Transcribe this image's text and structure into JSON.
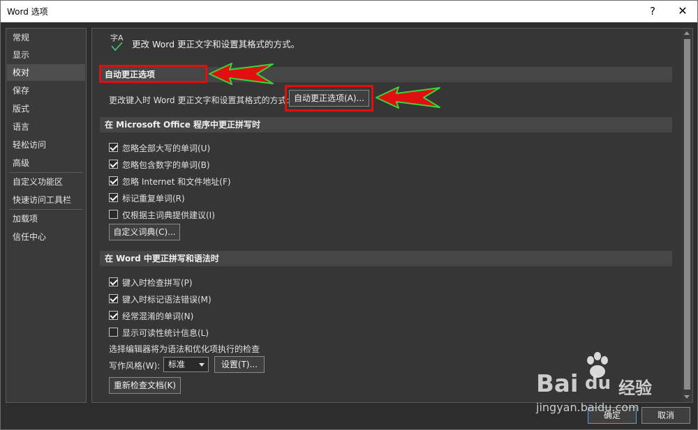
{
  "window": {
    "title": "Word 选项",
    "help_label": "?",
    "close_label": "✕"
  },
  "sidebar": {
    "items": [
      {
        "label": "常规"
      },
      {
        "label": "显示"
      },
      {
        "label": "校对"
      },
      {
        "label": "保存"
      },
      {
        "label": "版式"
      },
      {
        "label": "语言"
      },
      {
        "label": "轻松访问"
      },
      {
        "label": "高级"
      },
      {
        "label": "自定义功能区"
      },
      {
        "label": "快速访问工具栏"
      },
      {
        "label": "加载项"
      },
      {
        "label": "信任中心"
      }
    ],
    "active": "校对"
  },
  "header": {
    "icon_text": "字A",
    "text": "更改 Word 更正文字和设置其格式的方式。"
  },
  "autocorrect": {
    "section_title": "自动更正选项",
    "description": "更改键入时 Word 更正文字和设置其格式的方式:",
    "button_label": "自动更正选项(A)..."
  },
  "office_spelling": {
    "section_title": "在 Microsoft Office 程序中更正拼写时",
    "options": [
      {
        "label": "忽略全部大写的单词(U)",
        "checked": true
      },
      {
        "label": "忽略包含数字的单词(B)",
        "checked": true
      },
      {
        "label": "忽略 Internet 和文件地址(F)",
        "checked": true
      },
      {
        "label": "标记重复单词(R)",
        "checked": true
      },
      {
        "label": "仅根据主词典提供建议(I)",
        "checked": false
      }
    ],
    "custom_dict_button": "自定义词典(C)..."
  },
  "word_grammar": {
    "section_title": "在 Word 中更正拼写和语法时",
    "options": [
      {
        "label": "键入时检查拼写(P)",
        "checked": true
      },
      {
        "label": "键入时标记语法错误(M)",
        "checked": true
      },
      {
        "label": "经常混淆的单词(N)",
        "checked": true
      },
      {
        "label": "显示可读性统计信息(L)",
        "checked": false
      }
    ],
    "editor_note": "选择编辑器将为语法和优化项执行的检查",
    "writing_style_label": "写作风格(W):",
    "writing_style_value": "标准",
    "settings_button": "设置(T)...",
    "recheck_button": "重新检查文档(K)"
  },
  "footer": {
    "ok_label": "确定",
    "cancel_label": "取消"
  },
  "watermark": {
    "brand": "Bai",
    "brand_suffix": "经验",
    "url": "jingyan.baidu.com"
  },
  "colors": {
    "background": "#2d2d2d",
    "panel": "#363636",
    "section_bar": "#464646",
    "highlight_red": "#e01010",
    "arrow_fill": "#e01010",
    "arrow_outline": "#3ad43a"
  }
}
